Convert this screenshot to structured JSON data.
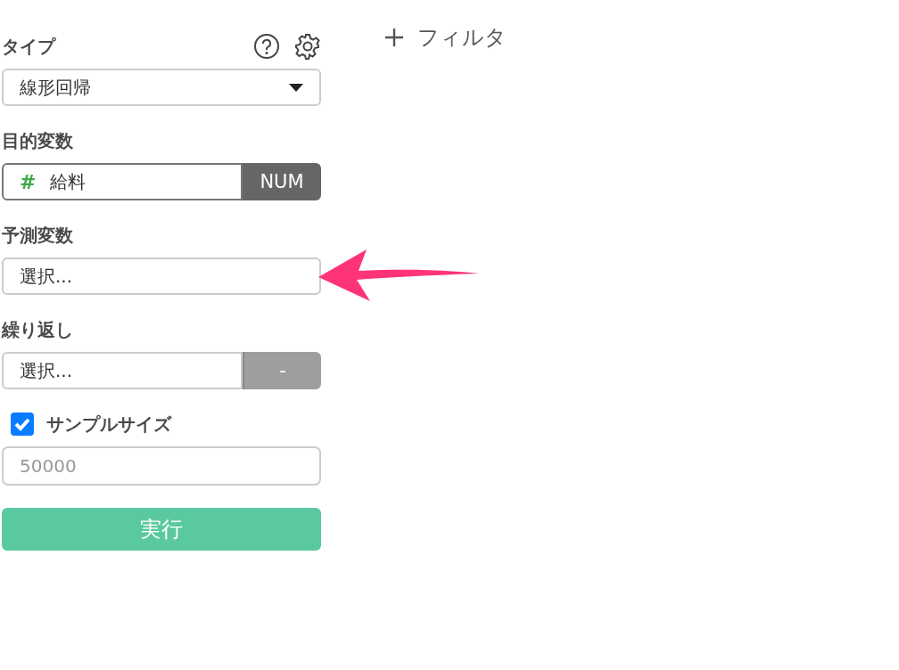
{
  "fields": [
    {
      "kind": "select",
      "label": "タイプ",
      "value": "線形回帰",
      "help": true,
      "settings": true
    },
    {
      "kind": "column",
      "label": "目的変数",
      "type_mark": "#",
      "value": "給料",
      "badge": "NUM"
    },
    {
      "kind": "picker",
      "label": "予測変数",
      "value": "選択..."
    },
    {
      "kind": "picker_button",
      "label": "繰り返し",
      "value": "選択...",
      "button": "-",
      "disabled": true
    },
    {
      "kind": "checkbox_input",
      "label": "サンプルサイズ",
      "checked": true,
      "placeholder": "50000"
    }
  ],
  "run_button": "実行",
  "filter_button": "フィルタ"
}
